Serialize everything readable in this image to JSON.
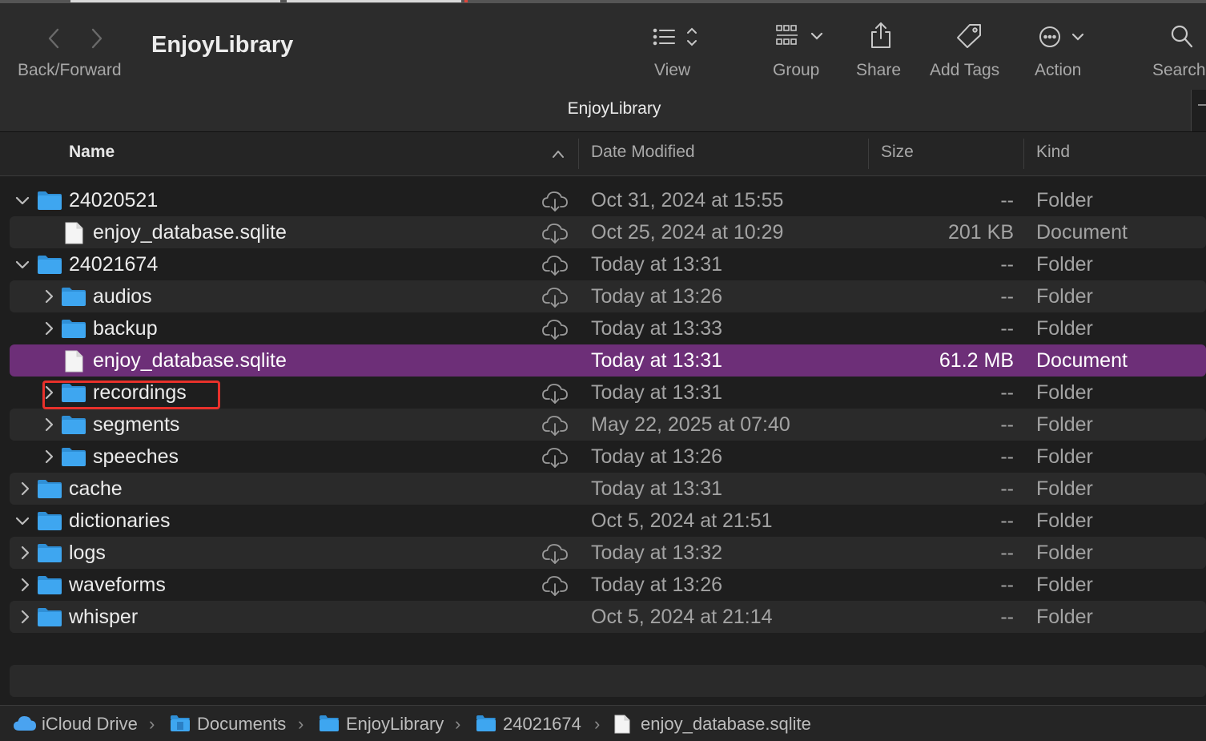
{
  "window": {
    "title": "EnjoyLibrary",
    "tab_title": "EnjoyLibrary"
  },
  "toolbar": {
    "back_forward_label": "Back/Forward",
    "view_label": "View",
    "group_label": "Group",
    "share_label": "Share",
    "add_tags_label": "Add Tags",
    "action_label": "Action",
    "search_label": "Search"
  },
  "columns": {
    "name": "Name",
    "date_modified": "Date Modified",
    "size": "Size",
    "kind": "Kind"
  },
  "rows": [
    {
      "name": "24020521",
      "date": "Oct 31, 2024 at 15:55",
      "size": "--",
      "kind": "Folder",
      "type": "folder",
      "indent": 0,
      "disclosure": "expanded",
      "cloud": true
    },
    {
      "name": "enjoy_database.sqlite",
      "date": "Oct 25, 2024 at 10:29",
      "size": "201 KB",
      "kind": "Document",
      "type": "file",
      "indent": 1,
      "disclosure": "none",
      "cloud": true
    },
    {
      "name": "24021674",
      "date": "Today at 13:31",
      "size": "--",
      "kind": "Folder",
      "type": "folder",
      "indent": 0,
      "disclosure": "expanded",
      "cloud": true
    },
    {
      "name": "audios",
      "date": "Today at 13:26",
      "size": "--",
      "kind": "Folder",
      "type": "folder",
      "indent": 1,
      "disclosure": "collapsed",
      "cloud": true
    },
    {
      "name": "backup",
      "date": "Today at 13:33",
      "size": "--",
      "kind": "Folder",
      "type": "folder",
      "indent": 1,
      "disclosure": "collapsed",
      "cloud": true
    },
    {
      "name": "enjoy_database.sqlite",
      "date": "Today at 13:31",
      "size": "61.2 MB",
      "kind": "Document",
      "type": "file",
      "indent": 1,
      "disclosure": "none",
      "cloud": false,
      "selected": true
    },
    {
      "name": "recordings",
      "date": "Today at 13:31",
      "size": "--",
      "kind": "Folder",
      "type": "folder",
      "indent": 1,
      "disclosure": "collapsed",
      "cloud": true
    },
    {
      "name": "segments",
      "date": "May 22, 2025 at 07:40",
      "size": "--",
      "kind": "Folder",
      "type": "folder",
      "indent": 1,
      "disclosure": "collapsed",
      "cloud": true
    },
    {
      "name": "speeches",
      "date": "Today at 13:26",
      "size": "--",
      "kind": "Folder",
      "type": "folder",
      "indent": 1,
      "disclosure": "collapsed",
      "cloud": true
    },
    {
      "name": "cache",
      "date": "Today at 13:31",
      "size": "--",
      "kind": "Folder",
      "type": "folder",
      "indent": 0,
      "disclosure": "collapsed",
      "cloud": false
    },
    {
      "name": "dictionaries",
      "date": "Oct 5, 2024 at 21:51",
      "size": "--",
      "kind": "Folder",
      "type": "folder",
      "indent": 0,
      "disclosure": "expanded",
      "cloud": false
    },
    {
      "name": "logs",
      "date": "Today at 13:32",
      "size": "--",
      "kind": "Folder",
      "type": "folder",
      "indent": 0,
      "disclosure": "collapsed",
      "cloud": true
    },
    {
      "name": "waveforms",
      "date": "Today at 13:26",
      "size": "--",
      "kind": "Folder",
      "type": "folder",
      "indent": 0,
      "disclosure": "collapsed",
      "cloud": true
    },
    {
      "name": "whisper",
      "date": "Oct 5, 2024 at 21:14",
      "size": "--",
      "kind": "Folder",
      "type": "folder",
      "indent": 0,
      "disclosure": "collapsed",
      "cloud": false
    }
  ],
  "path_bar": [
    {
      "label": "iCloud Drive",
      "icon": "icloud-icon"
    },
    {
      "label": "Documents",
      "icon": "documents-folder-icon"
    },
    {
      "label": "EnjoyLibrary",
      "icon": "folder-icon"
    },
    {
      "label": "24021674",
      "icon": "folder-icon"
    },
    {
      "label": "enjoy_database.sqlite",
      "icon": "document-icon"
    }
  ],
  "colors": {
    "selection": "#6d2f78",
    "folder_blue": "#3ea6f0",
    "annotation_red": "#e8312b"
  }
}
